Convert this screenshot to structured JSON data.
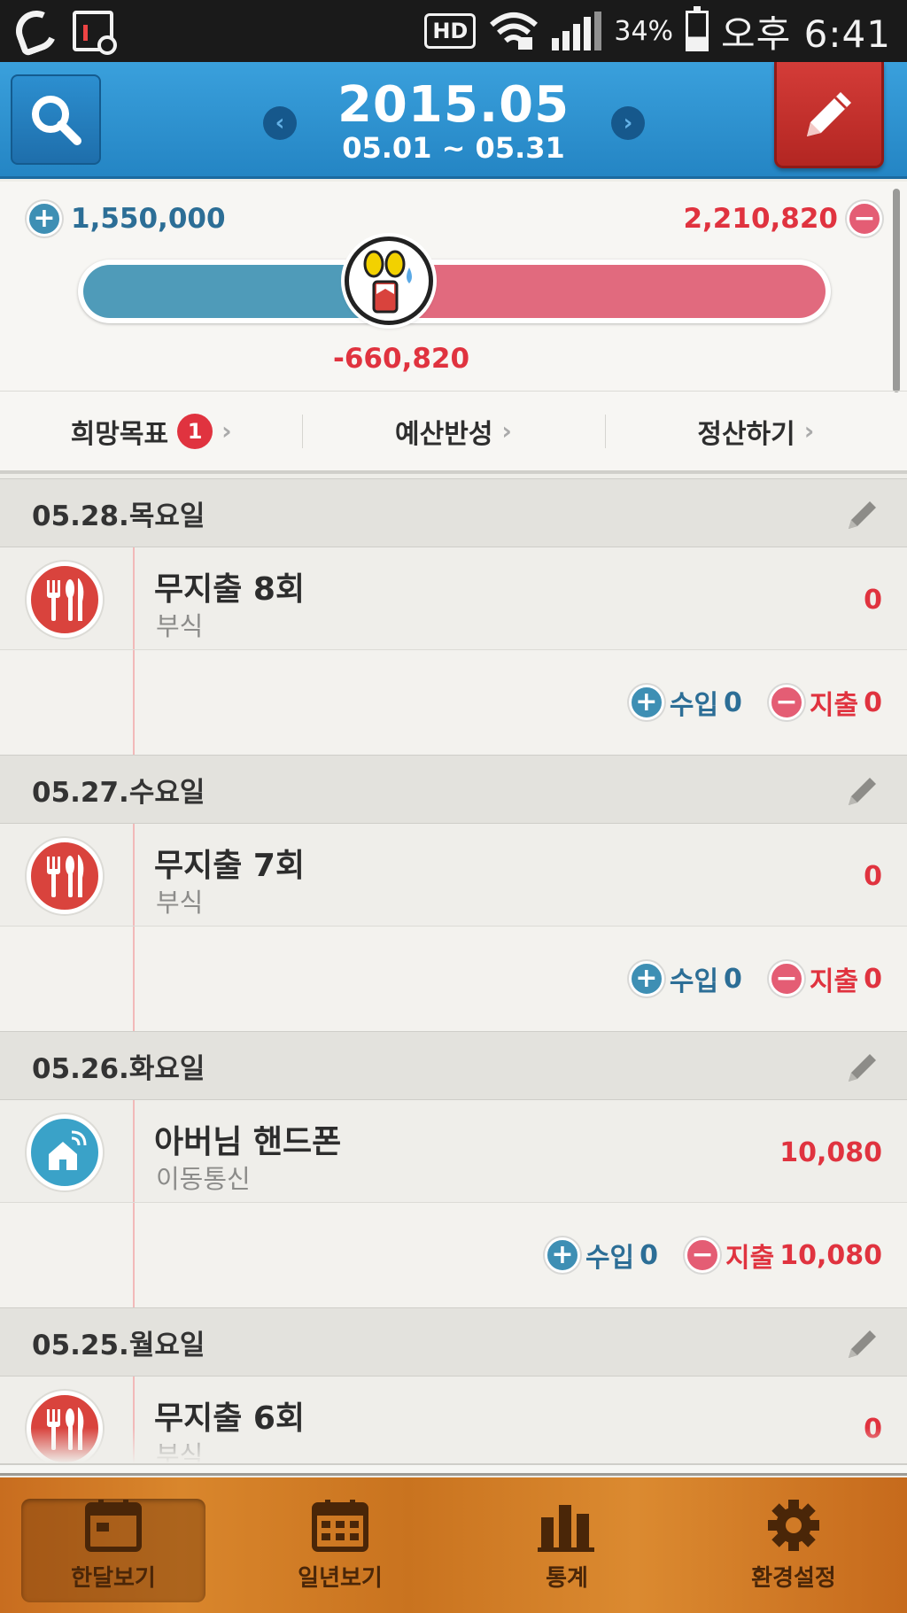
{
  "status_bar": {
    "hd": "HD",
    "battery": "34%",
    "time": "오후 6:41"
  },
  "header": {
    "title": "2015.05",
    "range": "05.01 ~ 05.31",
    "prev": "‹",
    "next": "›"
  },
  "summary": {
    "income_total": "1,550,000",
    "expense_total": "2,210,820",
    "difference": "-660,820",
    "income_ratio": 0.412,
    "colors": {
      "income": "#4f9bb9",
      "expense": "#e16a7e"
    }
  },
  "tabs": [
    {
      "label": "희망목표",
      "badge": "1"
    },
    {
      "label": "예산반성"
    },
    {
      "label": "정산하기"
    }
  ],
  "days": [
    {
      "date": "05.28.목요일",
      "entry": {
        "icon": "food-icon",
        "title": "무지출 8회",
        "category": "부식",
        "amount": "0"
      },
      "income_label": "수입",
      "income": "0",
      "expense_label": "지출",
      "expense": "0"
    },
    {
      "date": "05.27.수요일",
      "entry": {
        "icon": "food-icon",
        "title": "무지출 7회",
        "category": "부식",
        "amount": "0"
      },
      "income_label": "수입",
      "income": "0",
      "expense_label": "지출",
      "expense": "0"
    },
    {
      "date": "05.26.화요일",
      "entry": {
        "icon": "telecom-icon",
        "title": "아버님 핸드폰",
        "category": "이동통신",
        "amount": "10,080"
      },
      "income_label": "수입",
      "income": "0",
      "expense_label": "지출",
      "expense": "10,080"
    },
    {
      "date": "05.25.월요일",
      "entry": {
        "icon": "food-icon",
        "title": "무지출 6회",
        "category": "부식",
        "amount": "0"
      }
    }
  ],
  "bottom_nav": [
    {
      "label": "한달보기",
      "icon": "calendar-month-icon",
      "active": true
    },
    {
      "label": "일년보기",
      "icon": "calendar-year-icon"
    },
    {
      "label": "통계",
      "icon": "stats-icon"
    },
    {
      "label": "환경설정",
      "icon": "settings-icon"
    }
  ]
}
